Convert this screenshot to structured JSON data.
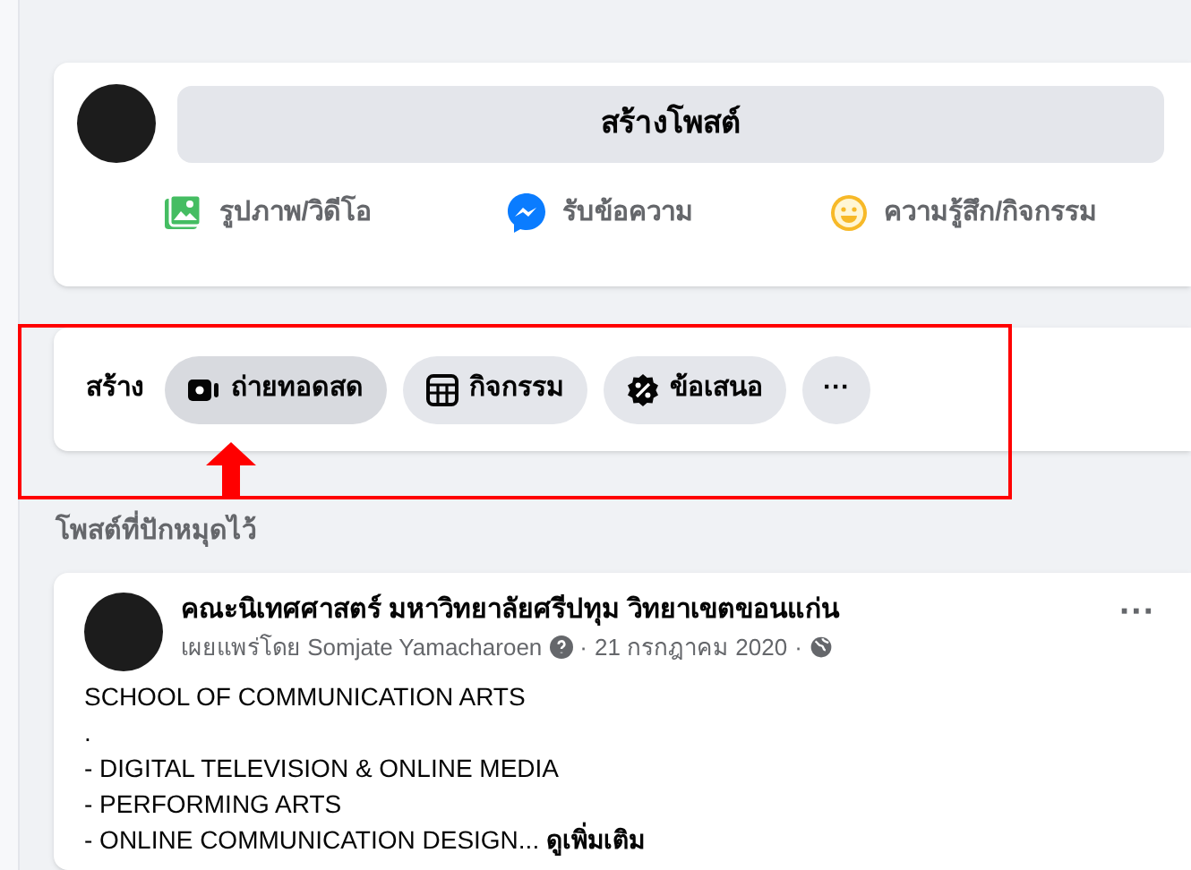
{
  "composer": {
    "button": "สร้างโพสต์",
    "actions": [
      {
        "kind": "photo",
        "label": "รูปภาพ/วิดีโอ"
      },
      {
        "kind": "messenger",
        "label": "รับข้อความ"
      },
      {
        "kind": "feeling",
        "label": "ความรู้สึก/กิจกรรม"
      }
    ]
  },
  "create": {
    "label": "สร้าง",
    "buttons": [
      {
        "kind": "live",
        "label": "ถ่ายทอดสด",
        "selected": true
      },
      {
        "kind": "event",
        "label": "กิจกรรม",
        "selected": false
      },
      {
        "kind": "offer",
        "label": "ข้อเสนอ",
        "selected": false
      },
      {
        "kind": "more",
        "label": "···",
        "selected": false
      }
    ]
  },
  "pinned_heading": "โพสต์ที่ปักหมุดไว้",
  "post": {
    "author": "คณะนิเทศศาสตร์ มหาวิทยาลัยศรีปทุม วิทยาเขตขอนแก่น",
    "published_by": "เผยแพร่โดย Somjate Yamacharoen",
    "separator": "·",
    "date": "21 กรกฎาคม 2020",
    "separator_2": "·",
    "more": "···",
    "lines": [
      "SCHOOL OF COMMUNICATION ARTS",
      ".",
      "- DIGITAL TELEVISION & ONLINE MEDIA",
      "- PERFORMING ARTS",
      "- ONLINE COMMUNICATION DESIGN..."
    ],
    "see_more": "ดูเพิ่มเติม"
  }
}
